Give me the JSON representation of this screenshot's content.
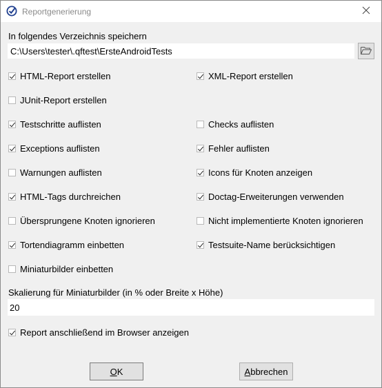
{
  "window": {
    "title": "Reportgenerierung"
  },
  "directory": {
    "label": "In folgendes Verzeichnis speichern",
    "value": "C:\\Users\\tester\\.qftest\\ErsteAndroidTests"
  },
  "options": [
    {
      "label": "HTML-Report erstellen",
      "checked": true
    },
    {
      "label": "XML-Report erstellen",
      "checked": true
    },
    {
      "label": "JUnit-Report erstellen",
      "checked": false
    },
    {
      "label": "Testschritte auflisten",
      "checked": true
    },
    {
      "label": "Checks auflisten",
      "checked": false
    },
    {
      "label": "Exceptions auflisten",
      "checked": true
    },
    {
      "label": "Fehler auflisten",
      "checked": true
    },
    {
      "label": "Warnungen auflisten",
      "checked": false
    },
    {
      "label": "Icons für Knoten anzeigen",
      "checked": true
    },
    {
      "label": "HTML-Tags durchreichen",
      "checked": true
    },
    {
      "label": "Doctag-Erweiterungen verwenden",
      "checked": true
    },
    {
      "label": "Übersprungene Knoten ignorieren",
      "checked": false
    },
    {
      "label": "Nicht implementierte Knoten ignorieren",
      "checked": false
    },
    {
      "label": "Tortendiagramm einbetten",
      "checked": true
    },
    {
      "label": "Testsuite-Name berücksichtigen",
      "checked": true
    },
    {
      "label": "Miniaturbilder einbetten",
      "checked": false
    }
  ],
  "scaling": {
    "label": "Skalierung für Miniaturbilder (in % oder Breite x Höhe)",
    "value": "20"
  },
  "show_in_browser": {
    "label": "Report anschließend im Browser anzeigen",
    "checked": true
  },
  "buttons": {
    "ok": {
      "mnemonic": "O",
      "rest": "K"
    },
    "cancel": {
      "mnemonic": "A",
      "rest": "bbrechen"
    }
  }
}
